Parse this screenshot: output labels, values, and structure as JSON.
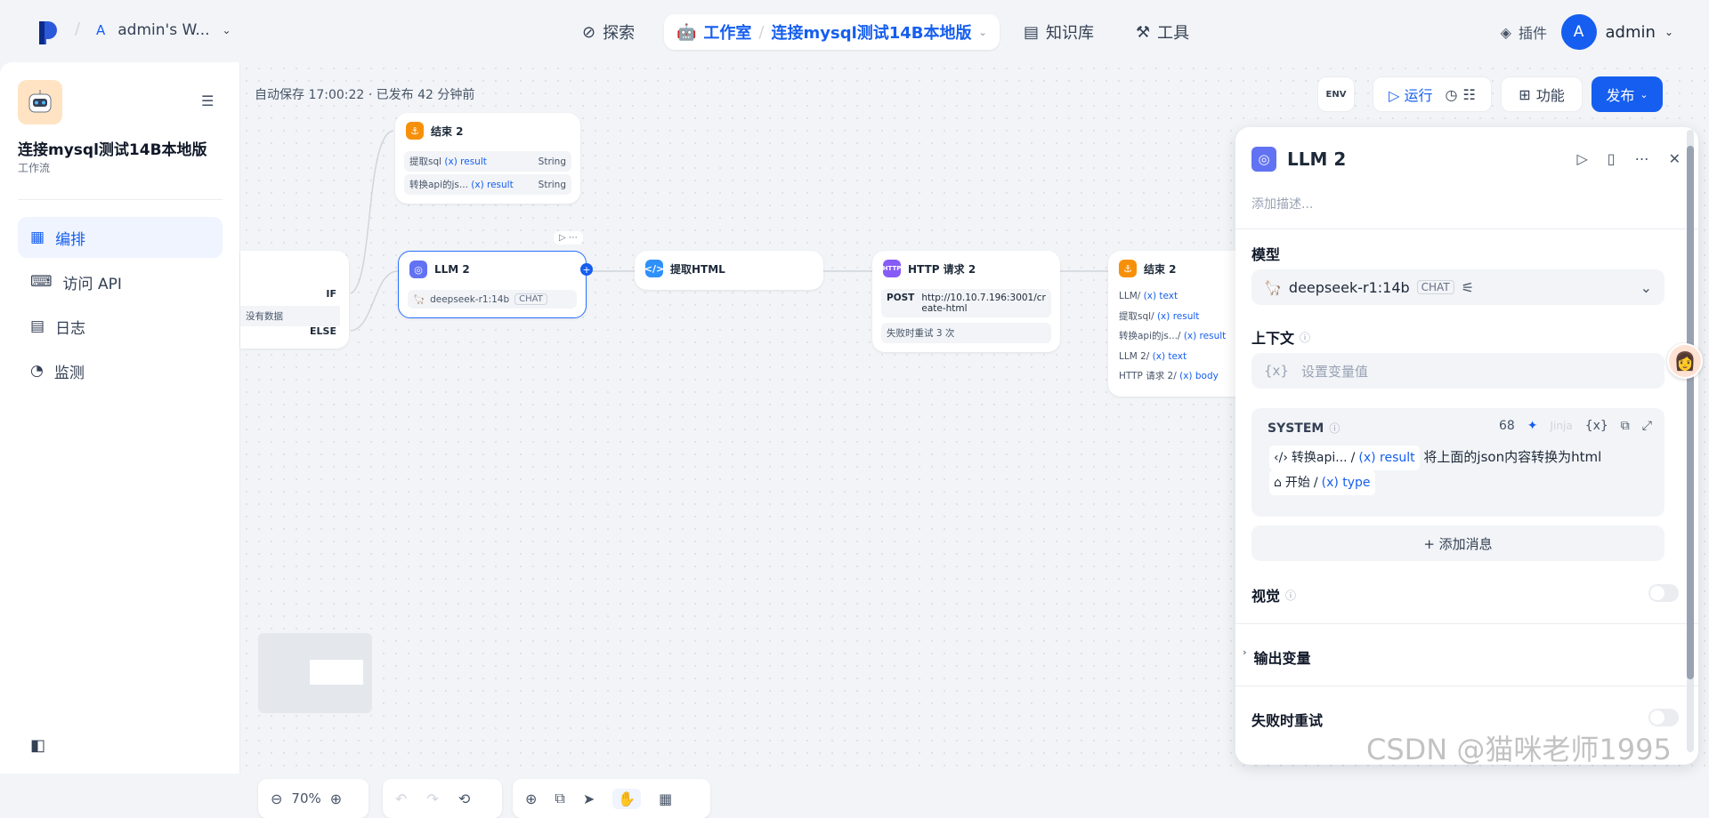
{
  "colors": {
    "accent": "#155eef",
    "llm": "#6172f3",
    "end": "#f79009",
    "code": "#2e90fa",
    "http": "#875bf7"
  },
  "topbar": {
    "workspace_initial": "A",
    "workspace_name": "admin's W...",
    "nav_explore": "探索",
    "nav_studio": "工作室",
    "nav_app": "连接mysql测试14B本地版",
    "nav_knowledge": "知识库",
    "nav_tools": "工具",
    "plugins": "插件",
    "user_initial": "A",
    "user_name": "admin"
  },
  "sidebar": {
    "app_title": "连接mysql测试14B本地版",
    "app_type": "工作流",
    "items": [
      {
        "label": "编排"
      },
      {
        "label": "访问 API"
      },
      {
        "label": "日志"
      },
      {
        "label": "监测"
      }
    ]
  },
  "canvas": {
    "status": "自动保存 17:00:22 · 已发布 42 分钟前",
    "toolbar": {
      "run": "运行",
      "features": "功能",
      "publish": "发布",
      "env": "ENV"
    },
    "zoom": "70%",
    "if_node": {
      "if": "IF",
      "else": "ELSE",
      "text": "没有数据"
    },
    "end_top": {
      "title": "结束 2",
      "rows": [
        {
          "name": "提取sql",
          "var": "(x) result",
          "type": "String"
        },
        {
          "name": "转换api的js...",
          "var": "(x) result",
          "type": "String"
        }
      ]
    },
    "llm_node": {
      "title": "LLM 2",
      "model": "deepseek-r1:14b",
      "tag": "CHAT"
    },
    "extract_html": {
      "title": "提取HTML"
    },
    "http_node": {
      "title": "HTTP 请求 2",
      "method": "POST",
      "url": "http://10.10.7.196:3001/create-html",
      "retry": "失败时重试 3 次"
    },
    "end_right": {
      "title": "结束 2",
      "rows": [
        {
          "name": "LLM",
          "var": "(x) text"
        },
        {
          "name": "提取sql",
          "var": "(x) result"
        },
        {
          "name": "转换api的js...",
          "var": "(x) result"
        },
        {
          "name": "LLM 2",
          "var": "(x) text"
        },
        {
          "name": "HTTP 请求 2",
          "var": "(x) body"
        }
      ]
    }
  },
  "panel": {
    "title": "LLM 2",
    "desc_placeholder": "添加描述...",
    "model_label": "模型",
    "model_name": "deepseek-r1:14b",
    "model_tag": "CHAT",
    "context_label": "上下文",
    "context_placeholder": "设置变量值",
    "system_label": "SYSTEM",
    "system_count": "68",
    "jinja": "Jinja",
    "sys_chip1": "转换api...",
    "sys_chip1_var": "(x) result",
    "sys_text": "将上面的json内容转换为html",
    "sys_chip2": "开始",
    "sys_chip2_var": "(x) type",
    "add_message": "+ 添加消息",
    "vision_label": "视觉",
    "output_label": "输出变量",
    "retry_label": "失败时重试"
  },
  "watermark": "CSDN @猫咪老师1995"
}
